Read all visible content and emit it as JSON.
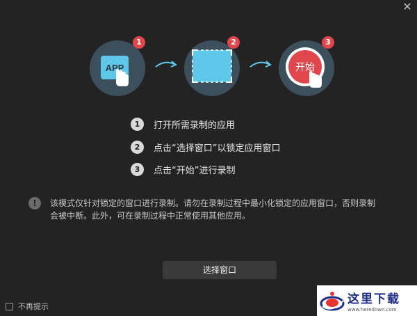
{
  "window": {
    "close_glyph": "✕"
  },
  "steps": [
    {
      "icon": "app-hand-icon",
      "badge": "1",
      "app_label": "APP"
    },
    {
      "icon": "window-selection-icon",
      "badge": "2"
    },
    {
      "icon": "start-button-icon",
      "badge": "3",
      "start_label": "开始"
    }
  ],
  "instructions": [
    {
      "num": "1",
      "text": "打开所需录制的应用"
    },
    {
      "num": "2",
      "text": "点击“选择窗口”以锁定应用窗口"
    },
    {
      "num": "3",
      "text": "点击“开始”进行录制"
    }
  ],
  "notice": {
    "icon": "info-icon",
    "icon_glyph": "!",
    "text": "该模式仅针对锁定的窗口进行录制。请勿在录制过程中最小化锁定的应用窗口，否则录制会被中断。此外，可在录制过程中正常使用其他应用。"
  },
  "select_button": {
    "label": "选择窗口"
  },
  "dont_show_again": {
    "label": "不再提示",
    "checked": false
  },
  "watermark": {
    "title": "这里下载",
    "url": "www.heredown.com"
  },
  "colors": {
    "background": "#232323",
    "badge": "#e0474c",
    "circle": "#3c4f5c",
    "selection": "#5fc8ea",
    "start": "#e0474c"
  }
}
